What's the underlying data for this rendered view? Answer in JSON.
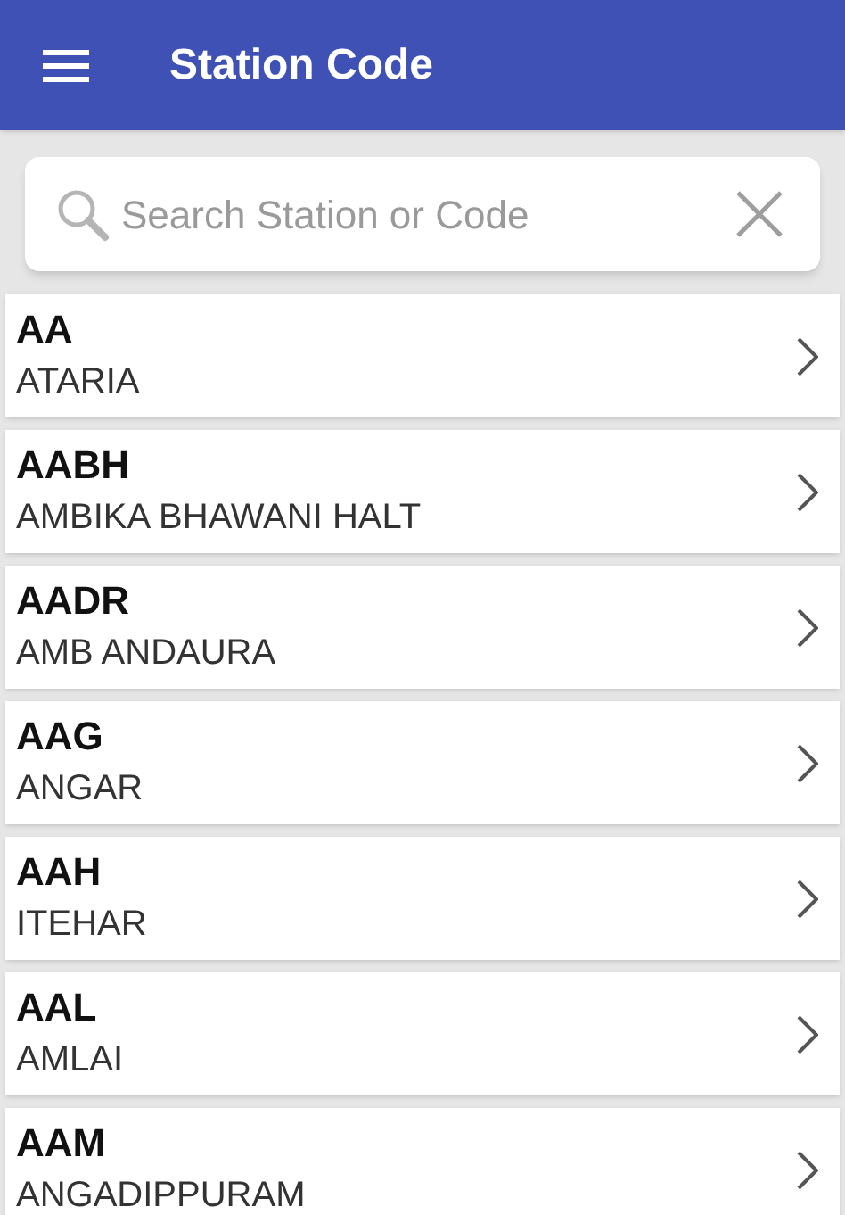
{
  "app_bar": {
    "title": "Station Code"
  },
  "search": {
    "placeholder": "Search Station or Code"
  },
  "stations": [
    {
      "code": "AA",
      "name": "ATARIA"
    },
    {
      "code": "AABH",
      "name": "AMBIKA BHAWANI HALT"
    },
    {
      "code": "AADR",
      "name": "AMB ANDAURA"
    },
    {
      "code": "AAG",
      "name": "ANGAR"
    },
    {
      "code": "AAH",
      "name": "ITEHAR"
    },
    {
      "code": "AAL",
      "name": "AMLAI"
    },
    {
      "code": "AAM",
      "name": "ANGADIPPURAM"
    }
  ]
}
